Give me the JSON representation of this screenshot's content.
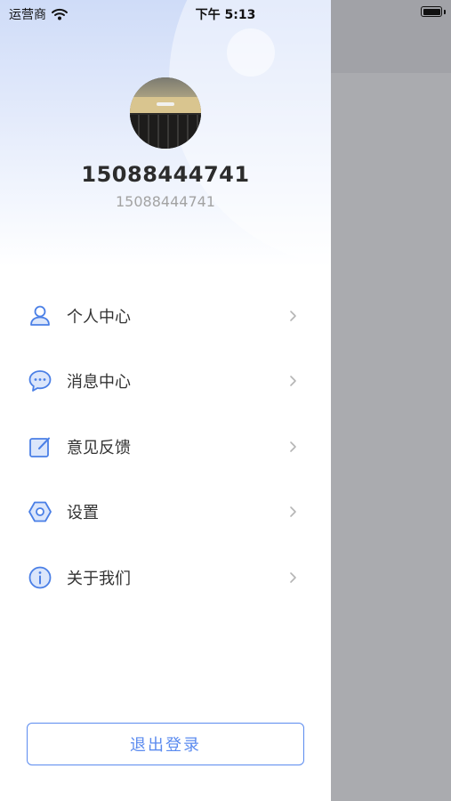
{
  "status_bar": {
    "carrier": "运营商",
    "time": "下午 5:13",
    "battery_level": 1.0
  },
  "profile": {
    "name": "15088444741",
    "subtitle": "15088444741"
  },
  "menu": {
    "items": [
      {
        "label": "个人中心",
        "icon": "user-icon"
      },
      {
        "label": "消息中心",
        "icon": "message-icon"
      },
      {
        "label": "意见反馈",
        "icon": "feedback-edit-icon"
      },
      {
        "label": "设置",
        "icon": "settings-hexagon-icon"
      },
      {
        "label": "关于我们",
        "icon": "info-icon"
      }
    ]
  },
  "logout": {
    "label": "退出登录"
  },
  "colors": {
    "accent": "#5b8bef",
    "icon": "#4a7fe6",
    "overlay": "#aaabaf",
    "text_primary": "#2c2c2c",
    "text_secondary": "#a3a3a3"
  }
}
